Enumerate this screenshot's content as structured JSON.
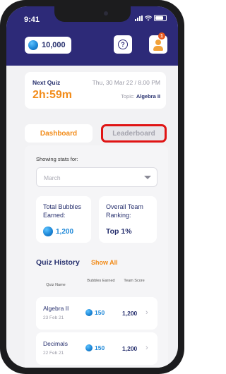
{
  "status_bar": {
    "time": "9:41"
  },
  "header": {
    "coins": "10,000",
    "help_glyph": "?",
    "notification_count": "1"
  },
  "next_quiz": {
    "label": "Next Quiz",
    "countdown": "2h:59m",
    "datetime": "Thu, 30 Mar 22 / 8.00 PM",
    "topic_prefix": "Topic:",
    "topic": "Algebra II"
  },
  "tabs": [
    {
      "label": "Dashboard",
      "state": "active"
    },
    {
      "label": "Leaderboard",
      "state": "inactive"
    }
  ],
  "stats": {
    "showing_label": "Showing stats for:",
    "dropdown_placeholder": "March",
    "total_bubbles_label": "Total Bubbles Earned:",
    "total_bubbles_value": "1,200",
    "team_ranking_label": "Overall Team Ranking:",
    "team_ranking_value": "Top 1%"
  },
  "history": {
    "title": "Quiz History",
    "show_all": "Show All",
    "columns": [
      "Quiz Name",
      "Bubbles Earned",
      "Team Score"
    ],
    "rows": [
      {
        "name": "Algebra II",
        "date": "23 Feb 21",
        "bubbles": "150",
        "score": "1,200"
      },
      {
        "name": "Decimals",
        "date": "22 Feb 21",
        "bubbles": "150",
        "score": "1,200"
      }
    ]
  },
  "icons": [
    "bubble-coin-icon",
    "help-icon",
    "profile-icon",
    "chevron-right-icon",
    "chevron-down-icon",
    "signal-icon",
    "wifi-icon",
    "battery-icon"
  ],
  "colors": {
    "header": "#2d2a78",
    "accent_orange": "#f28c1a",
    "coin_blue": "#1e88d8",
    "navy_text": "#27306e",
    "highlight_red": "#e01414"
  }
}
